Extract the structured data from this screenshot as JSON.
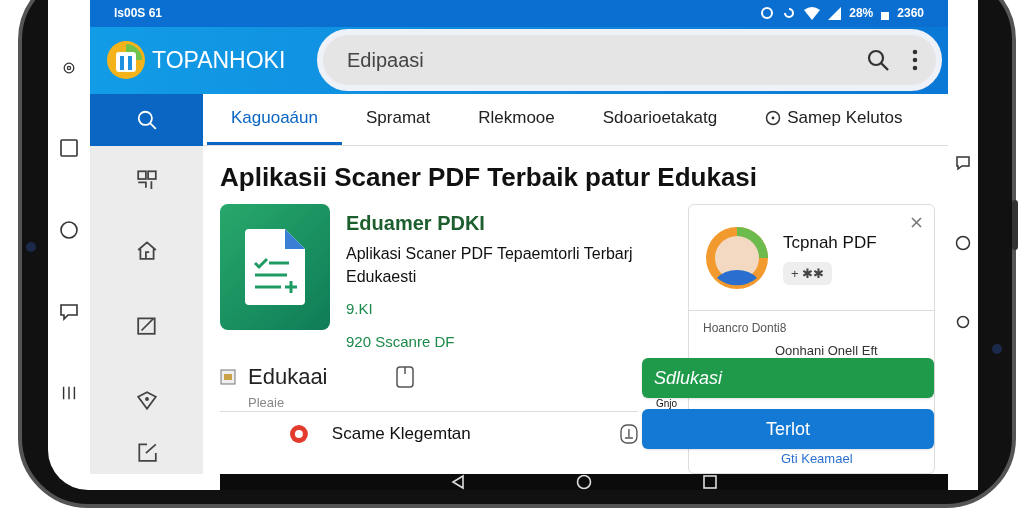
{
  "status_bar": {
    "left": "ls00S 61",
    "battery": "28%",
    "time": "2360"
  },
  "header": {
    "brand": "TOPANHOKI",
    "search": {
      "value": "Edipaasi"
    }
  },
  "sidebar": {
    "items": [
      {
        "selected": true
      },
      {
        "selected": false
      },
      {
        "selected": false
      },
      {
        "selected": false
      },
      {
        "selected": false
      },
      {
        "selected": false
      }
    ]
  },
  "tabs": [
    {
      "label": "Kaguoaáun",
      "selected": true
    },
    {
      "label": "Spramat",
      "selected": false
    },
    {
      "label": "Rlekmooe",
      "selected": false
    },
    {
      "label": "Sdoarioetakatg",
      "selected": false
    },
    {
      "label": "Samep Kelutos",
      "selected": false
    }
  ],
  "heading": "Aplikasii Scaner PDF Terbaik patur Edukasi",
  "app": {
    "name": "Eduamer PDKI",
    "description": "Aplikasi Scaner PDF Tepaemtorli Terbarj Edukaesti",
    "rating": "9.KI",
    "downloads": "920 Sscanre DF"
  },
  "list": [
    {
      "title": "Edukaai",
      "subtitle": "Pleaie"
    },
    {
      "title": "Scame Klegemtan"
    }
  ],
  "profile_card": {
    "name": "Tcpnah PDF",
    "badge": "+ ✱✱",
    "section": "Hoancro Donti8",
    "items": [
      "Oonhani Onell Eft",
      "Gti Keamael"
    ]
  },
  "actions": [
    {
      "label": "Sdlukasi",
      "kind": "green"
    },
    {
      "label": "Terlot",
      "kind": "blue"
    }
  ],
  "action_note": "Gnjo"
}
